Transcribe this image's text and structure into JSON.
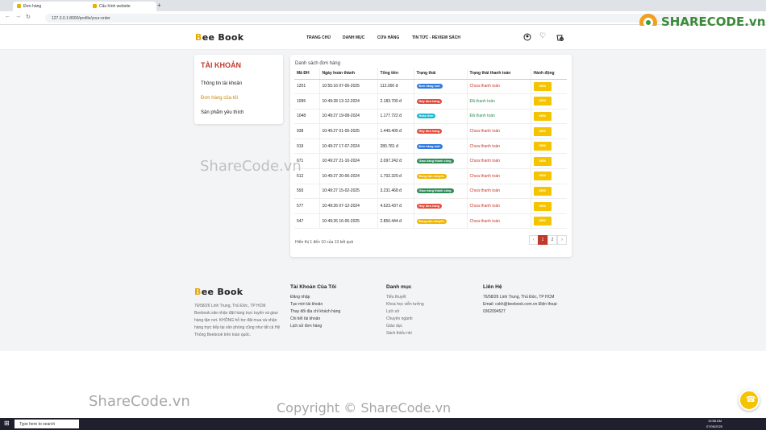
{
  "browser": {
    "tabs": [
      {
        "label": "Đơn hàng"
      },
      {
        "label": "Cấu hình website"
      }
    ],
    "url": "127.0.0.1:8000/profile/your-order"
  },
  "header": {
    "logo": {
      "prefix": "B",
      "rest": "ee Book"
    },
    "menu": [
      "TRANG CHỦ",
      "DANH MỤC",
      "CỬA HÀNG",
      "TIN TỨC - REVIEW SÁCH"
    ],
    "cart_count": "0"
  },
  "account": {
    "title": "TÀI KHOẢN",
    "items": [
      "Thông tin tài khoản",
      "Đơn hàng của tôi",
      "Sản phẩm yêu thích"
    ]
  },
  "orders": {
    "title": "Danh sách đơn hàng",
    "columns": [
      "Mã ĐH",
      "Ngày hoàn thành",
      "Tổng tiền",
      "Trạng thái",
      "Trạng thái thanh toán",
      "Hành động"
    ],
    "rows": [
      {
        "id": "1201",
        "date": "10:55:16 07-06-2025",
        "total": "112.000 đ",
        "status": "Đơn hàng mới",
        "pay": "Chưa thanh toán",
        "action": "XEM"
      },
      {
        "id": "1095",
        "date": "10:49:28 13-12-2024",
        "total": "2.183.700 đ",
        "status": "Hủy đơn hàng",
        "pay": "Đã thanh toán",
        "action": "XEM"
      },
      {
        "id": "1048",
        "date": "10:49:27 19-08-2024",
        "total": "1.177.722 đ",
        "status": "Hoàn đơn",
        "pay": "Đã thanh toán",
        "action": "XEM"
      },
      {
        "id": "938",
        "date": "10:49:27 01-05-2025",
        "total": "1.449.405 đ",
        "status": "Hủy đơn hàng",
        "pay": "Chưa thanh toán",
        "action": "XEM"
      },
      {
        "id": "919",
        "date": "10:49:27 17-07-2024",
        "total": "280.781 đ",
        "status": "Đơn hàng mới",
        "pay": "Chưa thanh toán",
        "action": "XEM"
      },
      {
        "id": "671",
        "date": "10:49:27 21-10-2024",
        "total": "2.097.242 đ",
        "status": "Giao hàng thành công",
        "pay": "Chưa thanh toán",
        "action": "XEM"
      },
      {
        "id": "612",
        "date": "10:49:27 20-06-2024",
        "total": "1.702.320 đ",
        "status": "Đang vận chuyển",
        "pay": "Chưa thanh toán",
        "action": "XEM"
      },
      {
        "id": "593",
        "date": "10:49:27 15-02-2025",
        "total": "3.231.468 đ",
        "status": "Giao hàng thành công",
        "pay": "Chưa thanh toán",
        "action": "XEM"
      },
      {
        "id": "577",
        "date": "10:49:26 07-12-2024",
        "total": "4.623.437 đ",
        "status": "Hủy đơn hàng",
        "pay": "Chưa thanh toán",
        "action": "XEM"
      },
      {
        "id": "547",
        "date": "10:49:26 16-05-2025",
        "total": "2.850.444 đ",
        "status": "Đang vận chuyển",
        "pay": "Chưa thanh toán",
        "action": "XEM"
      }
    ],
    "summary": "Hiển thị 1 đến 10 của 13 kết quả",
    "pagination": [
      "‹",
      "1",
      "2",
      "›"
    ]
  },
  "status_colors": {
    "Đơn hàng mới": "#2f7be0",
    "Hủy đơn hàng": "#e74c3c",
    "Hoàn đơn": "#17b8d6",
    "Giao hàng thành công": "#2e8b57",
    "Đang vận chuyển": "#f0b400"
  },
  "footer": {
    "about": "76/58/26 Linh Trung, Thủ Đức, TP HCM Beebook.site nhận đặt hàng trực tuyến và giao hàng tận nơi. KHÔNG hỗ trợ đặt mua và nhận hàng trực tiếp tại văn phòng cũng như tất cả Hệ Thống Beebook trên toàn quốc.",
    "account_title": "Tài Khoản Của Tôi",
    "account_links": [
      "Đăng nhập",
      "Tạo mới tài khoản",
      "Thay đổi địa chỉ khách hàng",
      "Chi tiết tài khoản",
      "Lịch sử đơn hàng"
    ],
    "category_title": "Danh mục",
    "category_links": [
      "Tiểu thuyết",
      "Khoa học viễn tưởng",
      "Lịch sử",
      "Chuyên ngành",
      "Giáo dục",
      "Sách thiếu nhi"
    ],
    "contact_title": "Liên Hệ",
    "contact_lines": [
      "76/58/26 Linh Trung, Thủ Đức, TP HCM",
      "Email: cskh@beebook.com.vn Điện thoại: 0362094527"
    ]
  },
  "watermarks": {
    "center": "ShareCode.vn",
    "bottom_left": "ShareCode.vn",
    "bottom_center": "Copyright © ShareCode.vn",
    "brand": "SHARECODE.vn"
  },
  "taskbar": {
    "search_placeholder": "Type here to search",
    "time": "10:58 AM",
    "date": "07/06/2025"
  }
}
